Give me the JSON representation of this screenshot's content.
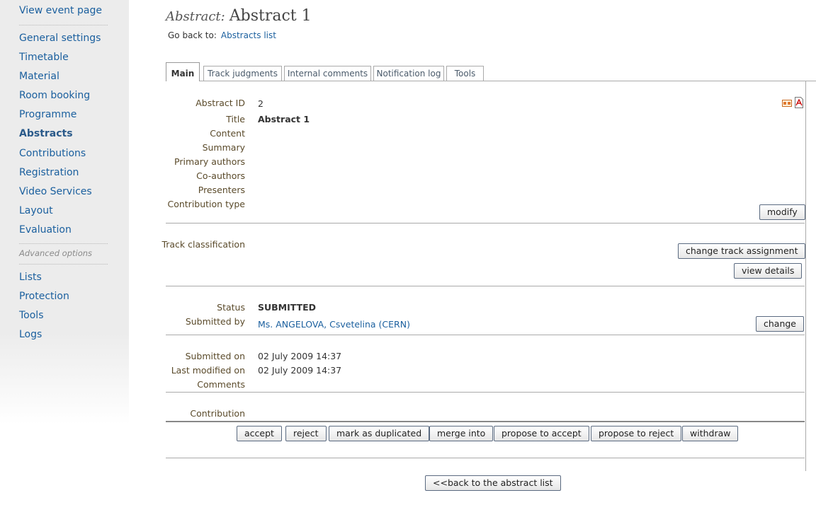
{
  "sidebar": {
    "top_link": "View event page",
    "items": [
      "General settings",
      "Timetable",
      "Material",
      "Room booking",
      "Programme",
      "Abstracts",
      "Contributions",
      "Registration",
      "Video Services",
      "Layout",
      "Evaluation"
    ],
    "advanced_heading": "Advanced options",
    "advanced_items": [
      "Lists",
      "Protection",
      "Tools",
      "Logs"
    ]
  },
  "header": {
    "title_label": "Abstract:",
    "title_value": "Abstract 1",
    "goback_label": "Go back to:",
    "goback_link": "Abstracts list"
  },
  "tabs": [
    "Main",
    "Track judgments",
    "Internal comments",
    "Notification log",
    "Tools"
  ],
  "fields": {
    "abstract_id": {
      "label": "Abstract ID",
      "value": "2"
    },
    "title": {
      "label": "Title",
      "value": "Abstract 1"
    },
    "content": {
      "label": "Content"
    },
    "summary": {
      "label": "Summary"
    },
    "primary_authors": {
      "label": "Primary authors"
    },
    "co_authors": {
      "label": "Co-authors"
    },
    "presenters": {
      "label": "Presenters"
    },
    "contribution_type": {
      "label": "Contribution type"
    },
    "track_classification": {
      "label": "Track classification"
    },
    "status": {
      "label": "Status",
      "value": "SUBMITTED"
    },
    "submitted_by": {
      "label": "Submitted by",
      "value": "Ms. ANGELOVA, Csvetelina (CERN)"
    },
    "submitted_on": {
      "label": "Submitted on",
      "value": "02 July 2009 14:37"
    },
    "last_modified": {
      "label": "Last modified on",
      "value": "02 July 2009 14:37"
    },
    "comments": {
      "label": "Comments"
    },
    "contribution": {
      "label": "Contribution"
    }
  },
  "buttons": {
    "modify": "modify",
    "change_track": "change track assignment",
    "view_details": "view details",
    "change": "change",
    "actions": [
      "accept",
      "reject",
      "mark as duplicated",
      "merge into",
      "propose to accept",
      "propose to reject",
      "withdraw"
    ],
    "back": "<<back to the abstract list"
  },
  "icons": {
    "xml": "xml-export-icon",
    "pdf": "pdf-export-icon"
  },
  "colors": {
    "link": "#1a5f9e",
    "label": "#5a4a2a",
    "sidebar_bg": "#ececec"
  }
}
